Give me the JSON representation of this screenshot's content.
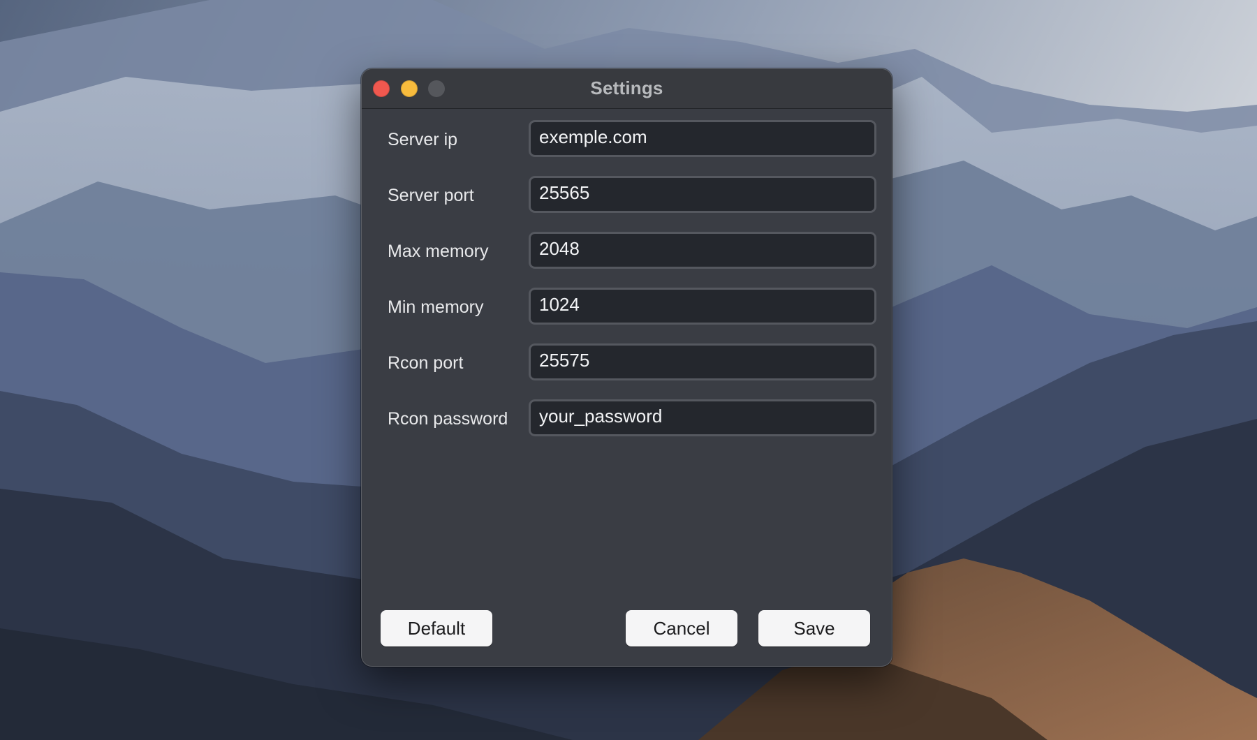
{
  "window": {
    "title": "Settings"
  },
  "form": {
    "fields": [
      {
        "label": "Server ip",
        "value": "exemple.com"
      },
      {
        "label": "Server port",
        "value": "25565"
      },
      {
        "label": "Max memory",
        "value": "2048"
      },
      {
        "label": "Min memory",
        "value": "1024"
      },
      {
        "label": "Rcon port",
        "value": "25575"
      },
      {
        "label": "Rcon password",
        "value": "your_password"
      }
    ]
  },
  "buttons": {
    "default_label": "Default",
    "cancel_label": "Cancel",
    "save_label": "Save"
  },
  "colors": {
    "window_bg": "#3a3d44",
    "input_bg": "#24272d",
    "close": "#f0584f",
    "minimize": "#f7bb3d",
    "zoom_disabled": "#55575c",
    "button_bg": "#f5f5f6"
  },
  "icons": {
    "close": "close-icon",
    "minimize": "minimize-icon",
    "zoom": "zoom-icon"
  }
}
